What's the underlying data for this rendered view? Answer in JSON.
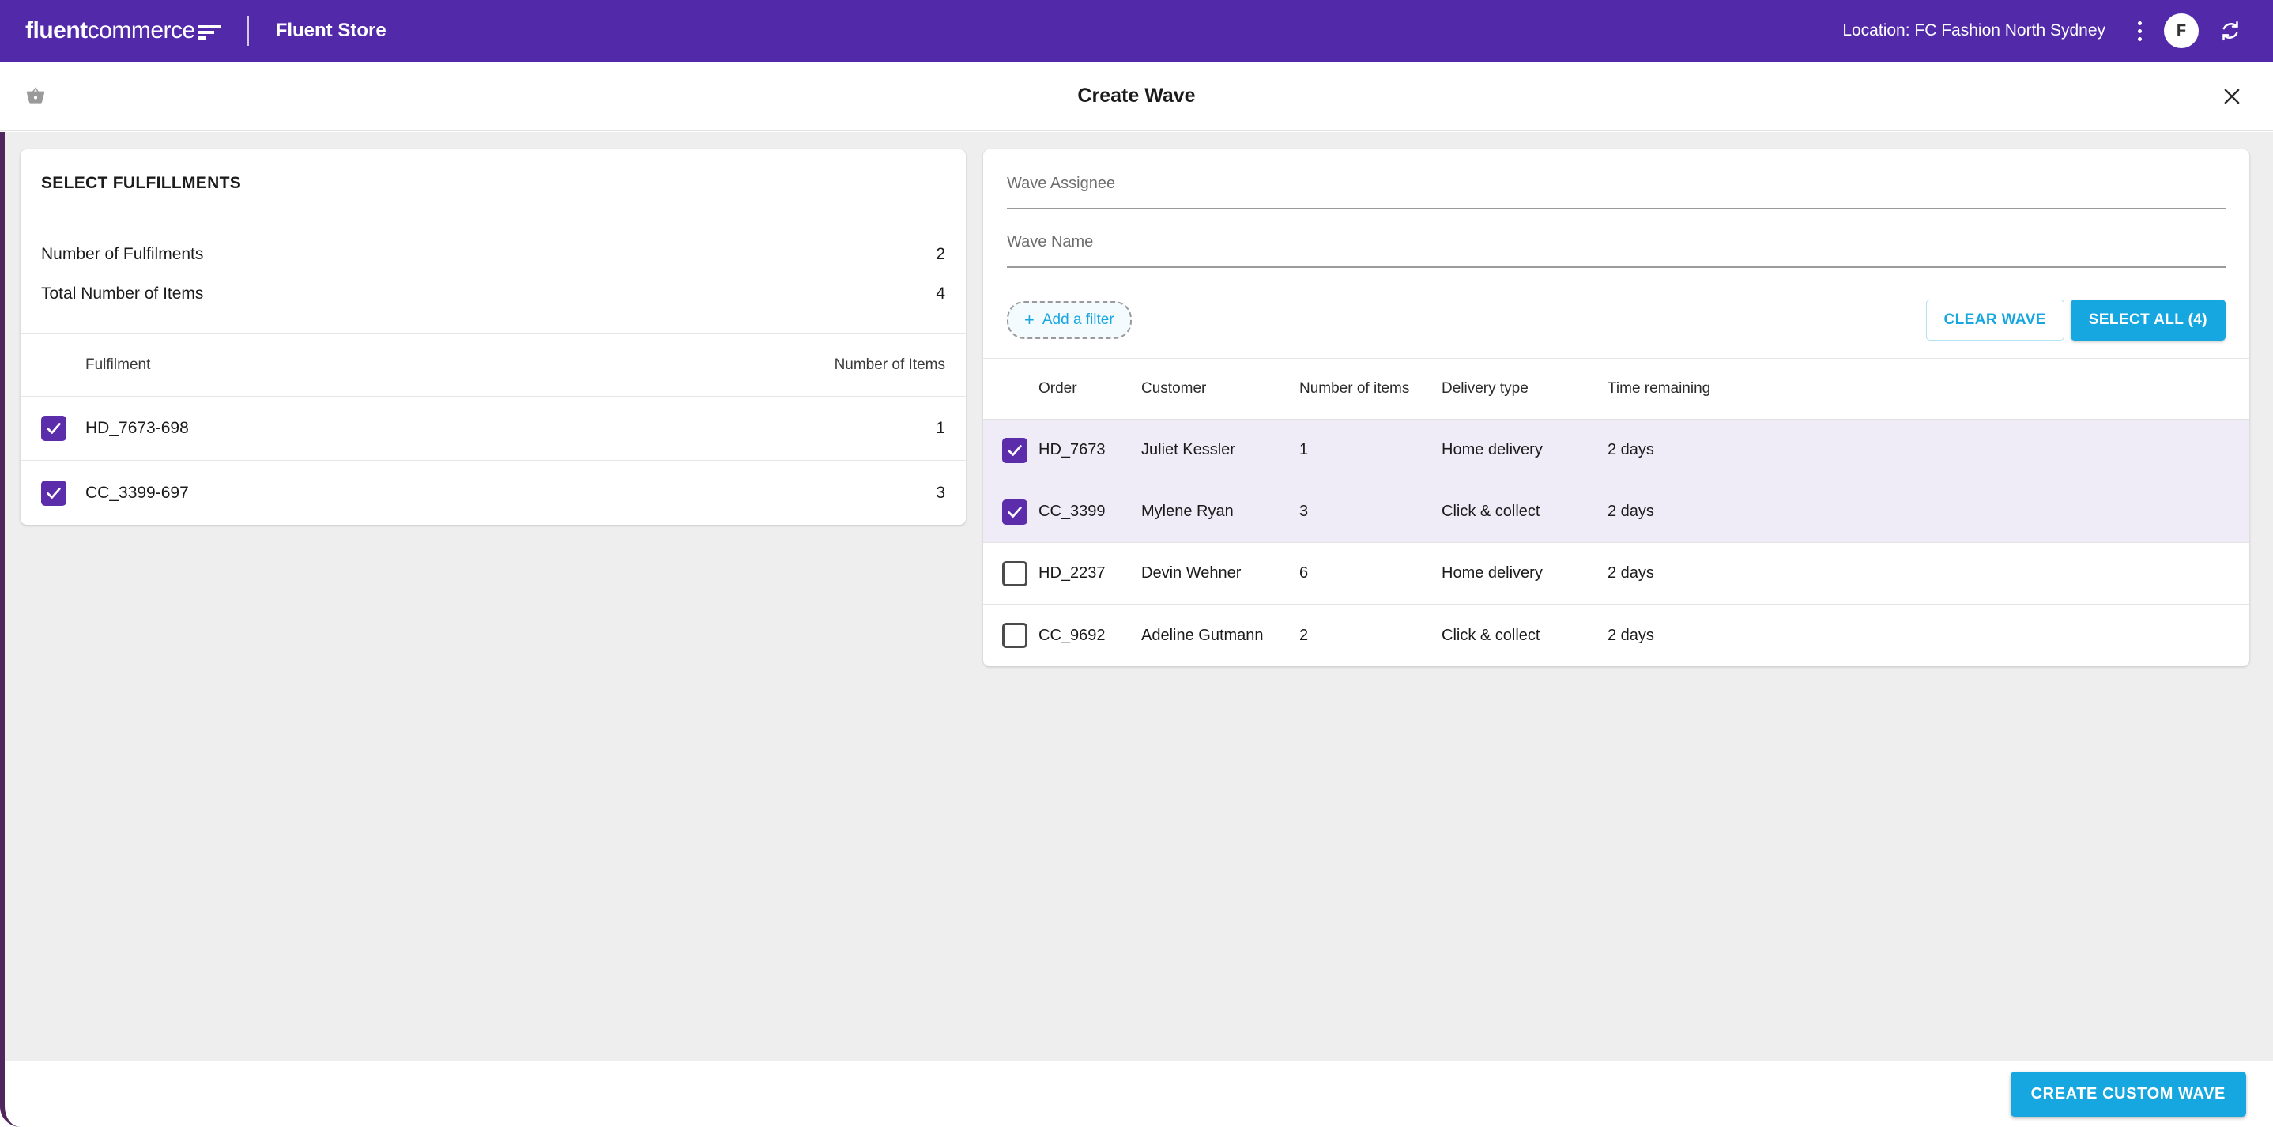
{
  "topbar": {
    "logo_text_bold": "fluent",
    "logo_text_regular": "commerce",
    "logo_mark": "three-bars-icon",
    "app_name": "Fluent Store",
    "location_label": "Location: FC Fashion North Sydney",
    "avatar_initial": "F",
    "menu_icon": "kebab-menu-icon",
    "sync_icon": "sync-icon",
    "background_color": "#5129a9"
  },
  "subheader": {
    "basket_icon": "shopping-basket-icon",
    "title": "Create Wave",
    "close_icon": "close-icon"
  },
  "left_panel": {
    "title": "SELECT FULFILLMENTS",
    "summary": [
      {
        "label": "Number of Fulfilments",
        "value": "2"
      },
      {
        "label": "Total Number of Items",
        "value": "4"
      }
    ],
    "columns": [
      "Fulfilment",
      "Number of Items"
    ],
    "rows": [
      {
        "checked": true,
        "fulfilment": "HD_7673-698",
        "items": "1"
      },
      {
        "checked": true,
        "fulfilment": "CC_3399-697",
        "items": "3"
      }
    ]
  },
  "right_panel": {
    "fields": [
      {
        "label": "Wave Assignee",
        "value": "",
        "placeholder": ""
      },
      {
        "label": "Wave Name",
        "value": "",
        "placeholder": ""
      }
    ],
    "add_filter_label": "Add a filter",
    "add_filter_plus": "+",
    "clear_wave_label": "CLEAR WAVE",
    "select_all_label": "SELECT ALL (4)",
    "columns": [
      "Order",
      "Customer",
      "Number of items",
      "Delivery type",
      "Time remaining"
    ],
    "rows": [
      {
        "checked": true,
        "order": "HD_7673",
        "customer": "Juliet Kessler",
        "items": "1",
        "delivery": "Home delivery",
        "time": "2 days"
      },
      {
        "checked": true,
        "order": "CC_3399",
        "customer": "Mylene Ryan",
        "items": "3",
        "delivery": "Click & collect",
        "time": "2 days"
      },
      {
        "checked": false,
        "order": "HD_2237",
        "customer": "Devin Wehner",
        "items": "6",
        "delivery": "Home delivery",
        "time": "2 days"
      },
      {
        "checked": false,
        "order": "CC_9692",
        "customer": "Adeline Gutmann",
        "items": "2",
        "delivery": "Click & collect",
        "time": "2 days"
      }
    ]
  },
  "bottombar": {
    "create_custom_wave_label": "CREATE CUSTOM WAVE"
  },
  "colors": {
    "brand_purple": "#5129a9",
    "accent_blue": "#17a7e0",
    "checkbox_purple": "#5b2dab",
    "selected_row": "#efecf7",
    "page_background": "#eeeeee",
    "sidebar_strip": "#50265f"
  }
}
